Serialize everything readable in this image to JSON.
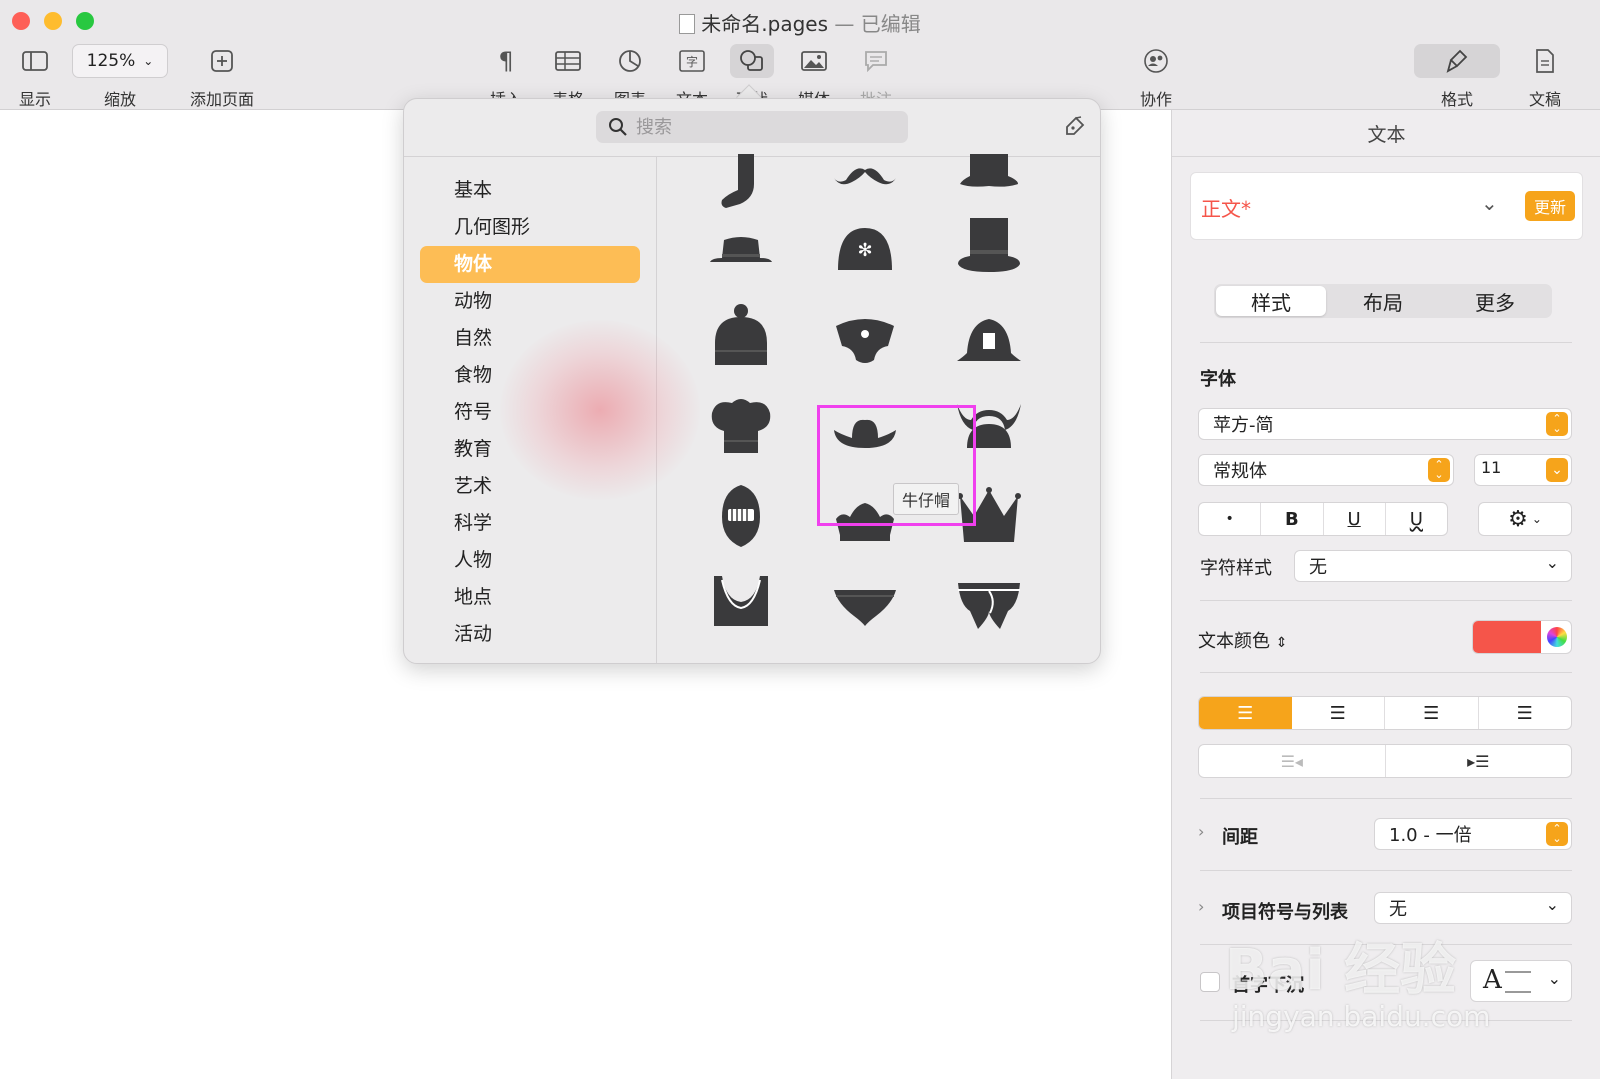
{
  "window": {
    "title": "未命名.pages",
    "separator": "—",
    "edited": "已编辑"
  },
  "toolbar": {
    "view_label": "显示",
    "zoom_value": "125%",
    "zoom_label": "缩放",
    "add_page_label": "添加页面",
    "insert_label": "插入",
    "table_label": "表格",
    "chart_label": "图表",
    "text_label": "文本",
    "shape_label": "形状",
    "media_label": "媒体",
    "comment_label": "批注",
    "collaborate_label": "协作",
    "format_label": "格式",
    "document_label": "文稿"
  },
  "shape_popover": {
    "search_placeholder": "搜索",
    "categories": [
      "基本",
      "几何图形",
      "物体",
      "动物",
      "自然",
      "食物",
      "符号",
      "教育",
      "艺术",
      "科学",
      "人物",
      "地点",
      "活动"
    ],
    "selected_category": "物体",
    "tooltip": "牛仔帽"
  },
  "sidebar": {
    "header": "文本",
    "paragraph_style": "正文*",
    "update_button": "更新",
    "tabs": [
      "样式",
      "布局",
      "更多"
    ],
    "font_section": "字体",
    "font_family": "苹方-简",
    "font_style": "常规体",
    "font_size": "11",
    "bold": "B",
    "underline": "U",
    "char_style_label": "字符样式",
    "char_style_value": "无",
    "text_color_label": "文本颜色",
    "text_color": "#f5554a",
    "spacing_label": "间距",
    "spacing_value": "1.0 - 一倍",
    "bullets_label": "项目符号与列表",
    "bullets_value": "无",
    "drop_cap_label": "首字下沉"
  },
  "watermark": {
    "text": "Bai 经验",
    "url": "jingyan.baidu.com"
  },
  "colors": {
    "accent": "#f6a41b",
    "selection": "#fdbd55",
    "highlight_box": "#f040ee",
    "paragraph_style_text": "#f5554a"
  }
}
